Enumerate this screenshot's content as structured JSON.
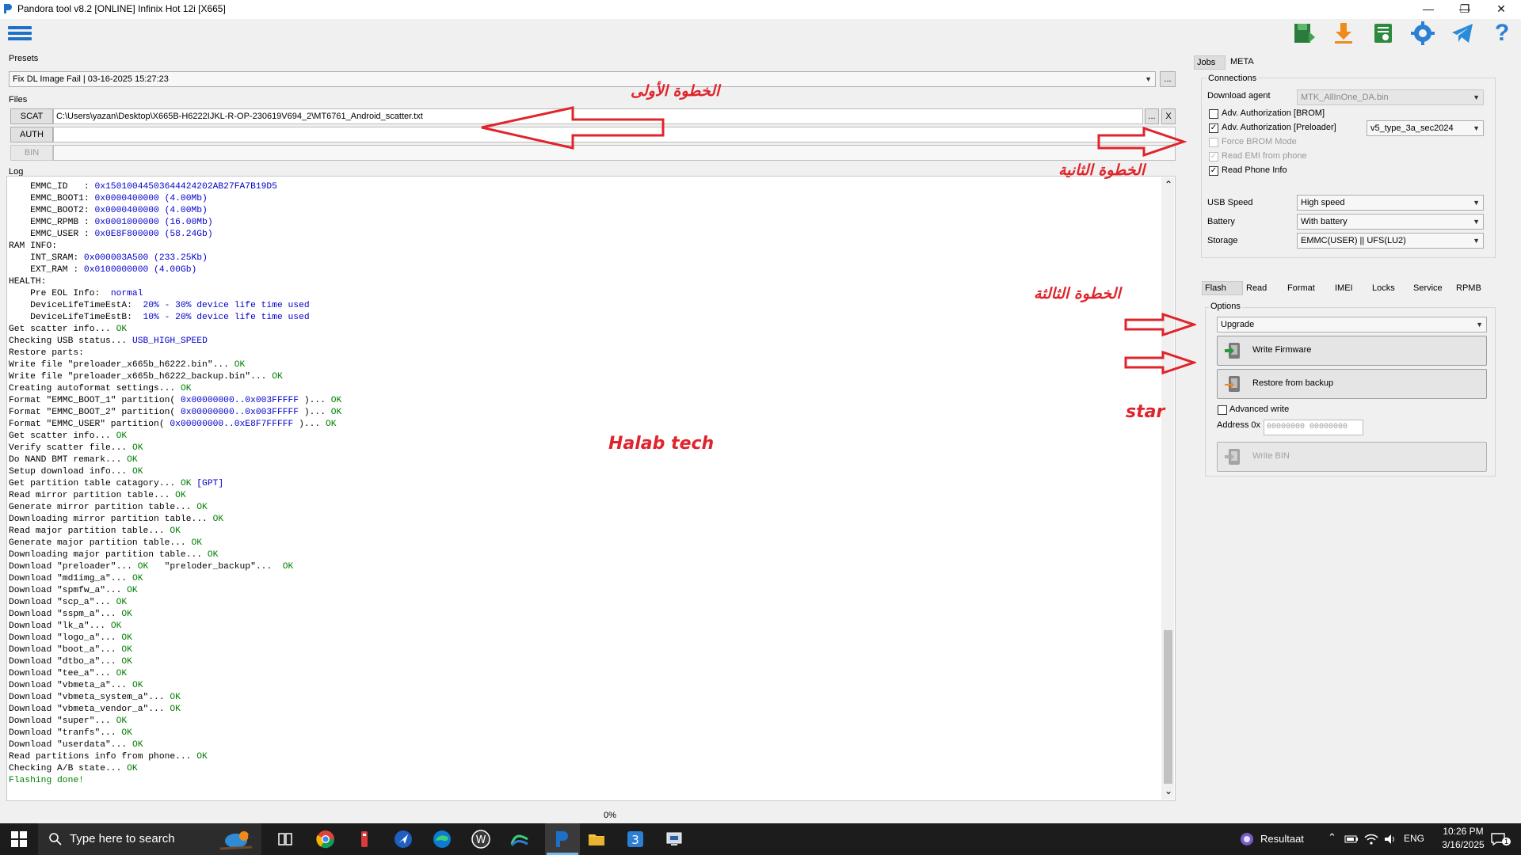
{
  "window": {
    "title": "Pandora tool v8.2 [ONLINE] Infinix Hot 12i [X665]",
    "minimize": "—",
    "restore": "❐",
    "close": "✕"
  },
  "toolbar": {
    "icons": [
      "menu-icon",
      "save-icon",
      "download-icon",
      "sheet-icon",
      "settings-icon",
      "telegram-icon",
      "help-icon"
    ],
    "help_label": "?"
  },
  "presets": {
    "label": "Presets",
    "value": "Fix DL Image Fail | 03-16-2025 15:27:23",
    "more": "..."
  },
  "files": {
    "label": "Files",
    "scat_label": "SCAT",
    "scat_path": "C:\\Users\\yazan\\Desktop\\X665B-H6222IJKL-R-OP-230619V694_2\\MT6761_Android_scatter.txt",
    "scat_more": "...",
    "scat_clear": "X",
    "auth_label": "AUTH",
    "auth_path": "",
    "bin_label": "BIN",
    "bin_path": ""
  },
  "log": {
    "label": "Log",
    "lines": [
      [
        [
          "n",
          "    EMMC_ID   : "
        ],
        [
          "v",
          "0x15010044503644424202AB27FA7B19D5"
        ]
      ],
      [
        [
          "n",
          "    EMMC_BOOT1: "
        ],
        [
          "v",
          "0x0000400000 (4.00Mb)"
        ]
      ],
      [
        [
          "n",
          "    EMMC_BOOT2: "
        ],
        [
          "v",
          "0x0000400000 (4.00Mb)"
        ]
      ],
      [
        [
          "n",
          "    EMMC_RPMB : "
        ],
        [
          "v",
          "0x0001000000 (16.00Mb)"
        ]
      ],
      [
        [
          "n",
          "    EMMC_USER : "
        ],
        [
          "v",
          "0x0E8F800000 (58.24Gb)"
        ]
      ],
      [
        [
          "n",
          "RAM INFO:"
        ]
      ],
      [
        [
          "n",
          "    INT_SRAM: "
        ],
        [
          "v",
          "0x000003A500 (233.25Kb)"
        ]
      ],
      [
        [
          "n",
          "    EXT_RAM : "
        ],
        [
          "v",
          "0x0100000000 (4.00Gb)"
        ]
      ],
      [
        [
          "n",
          "HEALTH:"
        ]
      ],
      [
        [
          "n",
          "    Pre EOL Info:  "
        ],
        [
          "v",
          "normal"
        ]
      ],
      [
        [
          "n",
          "    DeviceLifeTimeEstA:  "
        ],
        [
          "v",
          "20% - 30% device life time used"
        ]
      ],
      [
        [
          "n",
          "    DeviceLifeTimeEstB:  "
        ],
        [
          "v",
          "10% - 20% device life time used"
        ]
      ],
      [
        [
          "n",
          "Get scatter info... "
        ],
        [
          "g",
          "OK"
        ]
      ],
      [
        [
          "n",
          "Checking USB status... "
        ],
        [
          "v",
          "USB_HIGH_SPEED"
        ]
      ],
      [
        [
          "n",
          "Restore parts:"
        ]
      ],
      [
        [
          "n",
          "Write file \"preloader_x665b_h6222.bin\"... "
        ],
        [
          "g",
          "OK"
        ]
      ],
      [
        [
          "n",
          "Write file \"preloader_x665b_h6222_backup.bin\"... "
        ],
        [
          "g",
          "OK"
        ]
      ],
      [
        [
          "n",
          "Creating autoformat settings... "
        ],
        [
          "g",
          "OK"
        ]
      ],
      [
        [
          "n",
          "Format \"EMMC_BOOT_1\" partition( "
        ],
        [
          "v",
          "0x00000000..0x003FFFFF"
        ],
        [
          "n",
          " )... "
        ],
        [
          "g",
          "OK"
        ]
      ],
      [
        [
          "n",
          "Format \"EMMC_BOOT_2\" partition( "
        ],
        [
          "v",
          "0x00000000..0x003FFFFF"
        ],
        [
          "n",
          " )... "
        ],
        [
          "g",
          "OK"
        ]
      ],
      [
        [
          "n",
          "Format \"EMMC_USER\" partition( "
        ],
        [
          "v",
          "0x00000000..0xE8F7FFFFF"
        ],
        [
          "n",
          " )... "
        ],
        [
          "g",
          "OK"
        ]
      ],
      [
        [
          "n",
          "Get scatter info... "
        ],
        [
          "g",
          "OK"
        ]
      ],
      [
        [
          "n",
          "Verify scatter file... "
        ],
        [
          "g",
          "OK"
        ]
      ],
      [
        [
          "n",
          "Do NAND BMT remark... "
        ],
        [
          "g",
          "OK"
        ]
      ],
      [
        [
          "n",
          "Setup download info... "
        ],
        [
          "g",
          "OK"
        ]
      ],
      [
        [
          "n",
          "Get partition table catagory... "
        ],
        [
          "g",
          "OK"
        ],
        [
          "n",
          " "
        ],
        [
          "v",
          "[GPT]"
        ]
      ],
      [
        [
          "n",
          "Read mirror partition table... "
        ],
        [
          "g",
          "OK"
        ]
      ],
      [
        [
          "n",
          "Generate mirror partition table... "
        ],
        [
          "g",
          "OK"
        ]
      ],
      [
        [
          "n",
          "Downloading mirror partition table... "
        ],
        [
          "g",
          "OK"
        ]
      ],
      [
        [
          "n",
          "Read major partition table... "
        ],
        [
          "g",
          "OK"
        ]
      ],
      [
        [
          "n",
          "Generate major partition table... "
        ],
        [
          "g",
          "OK"
        ]
      ],
      [
        [
          "n",
          "Downloading major partition table... "
        ],
        [
          "g",
          "OK"
        ]
      ],
      [
        [
          "n",
          "Download \"preloader\"... "
        ],
        [
          "g",
          "OK"
        ],
        [
          "n",
          "   \"preloder_backup\"...  "
        ],
        [
          "g",
          "OK"
        ]
      ],
      [
        [
          "n",
          "Download \"md1img_a\"... "
        ],
        [
          "g",
          "OK"
        ]
      ],
      [
        [
          "n",
          "Download \"spmfw_a\"... "
        ],
        [
          "g",
          "OK"
        ]
      ],
      [
        [
          "n",
          "Download \"scp_a\"... "
        ],
        [
          "g",
          "OK"
        ]
      ],
      [
        [
          "n",
          "Download \"sspm_a\"... "
        ],
        [
          "g",
          "OK"
        ]
      ],
      [
        [
          "n",
          "Download \"lk_a\"... "
        ],
        [
          "g",
          "OK"
        ]
      ],
      [
        [
          "n",
          "Download \"logo_a\"... "
        ],
        [
          "g",
          "OK"
        ]
      ],
      [
        [
          "n",
          "Download \"boot_a\"... "
        ],
        [
          "g",
          "OK"
        ]
      ],
      [
        [
          "n",
          "Download \"dtbo_a\"... "
        ],
        [
          "g",
          "OK"
        ]
      ],
      [
        [
          "n",
          "Download \"tee_a\"... "
        ],
        [
          "g",
          "OK"
        ]
      ],
      [
        [
          "n",
          "Download \"vbmeta_a\"... "
        ],
        [
          "g",
          "OK"
        ]
      ],
      [
        [
          "n",
          "Download \"vbmeta_system_a\"... "
        ],
        [
          "g",
          "OK"
        ]
      ],
      [
        [
          "n",
          "Download \"vbmeta_vendor_a\"... "
        ],
        [
          "g",
          "OK"
        ]
      ],
      [
        [
          "n",
          "Download \"super\"... "
        ],
        [
          "g",
          "OK"
        ]
      ],
      [
        [
          "n",
          "Download \"tranfs\"... "
        ],
        [
          "g",
          "OK"
        ]
      ],
      [
        [
          "n",
          "Download \"userdata\"... "
        ],
        [
          "g",
          "OK"
        ]
      ],
      [
        [
          "n",
          "Read partitions info from phone... "
        ],
        [
          "g",
          "OK"
        ]
      ],
      [
        [
          "n",
          "Checking A/B state... "
        ],
        [
          "g",
          "OK"
        ]
      ],
      [
        [
          "g",
          "Flashing done!"
        ]
      ]
    ],
    "scroll_up": "⌃",
    "scroll_down": "⌄",
    "scroll_position": 0.72
  },
  "progress": {
    "text": "0%",
    "value": 0
  },
  "annotations": {
    "step1": "الخطوة الأولى",
    "step2": "الخطوة الثانية",
    "step3": "الخطوة الثالثة",
    "star": "star",
    "halab": "Halab tech"
  },
  "top_tabs": {
    "jobs": "Jobs",
    "meta": "META"
  },
  "connections": {
    "label": "Connections",
    "download_agent_label": "Download agent",
    "download_agent_value": "MTK_AllInOne_DA.bin",
    "adv_auth_brom": "Adv. Authorization [BROM]",
    "adv_auth_preloader": "Adv. Authorization [Preloader]",
    "preloader_type": "v5_type_3a_sec2024",
    "force_brom": "Force BROM Mode",
    "read_emi": "Read EMI from phone",
    "read_phone_info": "Read Phone Info",
    "usb_speed_label": "USB Speed",
    "usb_speed_value": "High speed",
    "battery_label": "Battery",
    "battery_value": "With battery",
    "storage_label": "Storage",
    "storage_value": "EMMC(USER) || UFS(LU2)"
  },
  "tabs": {
    "flash": "Flash",
    "read": "Read",
    "format": "Format",
    "imei": "IMEI",
    "locks": "Locks",
    "service": "Service",
    "rpmb": "RPMB"
  },
  "options": {
    "label": "Options",
    "mode_value": "Upgrade",
    "write_firmware": "Write Firmware",
    "restore_backup": "Restore from backup",
    "advanced_write": "Advanced write",
    "address_label": "Address 0x",
    "address_placeholder": "00000000  00000000",
    "write_bin": "Write BIN"
  },
  "taskbar": {
    "search_placeholder": "Type here to search",
    "weather": "Resultaat",
    "language": "ENG",
    "time": "10:26 PM",
    "date": "3/16/2025",
    "notification_count": "1"
  },
  "colors": {
    "accent": "#1e6fc8",
    "annotation": "#e0242b",
    "ok": "#008000",
    "value": "#0000cc"
  }
}
